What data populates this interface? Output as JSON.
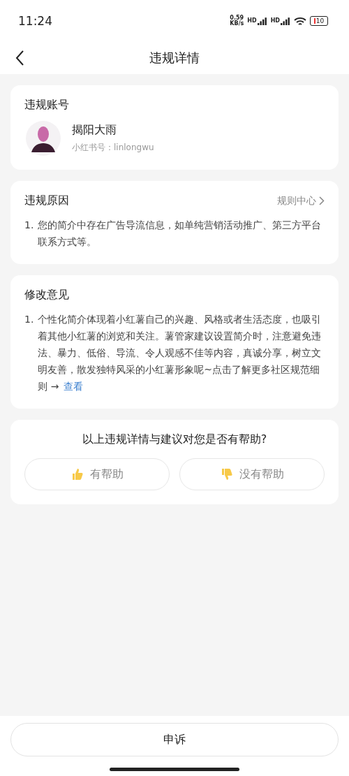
{
  "status_bar": {
    "time": "11:24",
    "speed_value": "0.59",
    "speed_unit": "KB/s",
    "signal_labels": [
      "HD",
      "HD"
    ],
    "battery": "10"
  },
  "header": {
    "title": "违规详情"
  },
  "account": {
    "title": "违规账号",
    "name": "揭阳大雨",
    "handle": "小红书号：linlongwu"
  },
  "reason": {
    "title": "违规原因",
    "link": "规则中心",
    "items": [
      {
        "number": "1.",
        "text": "您的简介中存在广告导流信息，如单纯营销活动推广、第三方平台联系方式等。"
      }
    ]
  },
  "advice": {
    "title": "修改意见",
    "items": [
      {
        "number": "1.",
        "text": "个性化简介体现着小红薯自己的兴趣、风格或者生活态度，也吸引着其他小红薯的浏览和关注。薯管家建议设置简介时，注意避免违法、暴力、低俗、导流、令人观感不佳等内容，真诚分享，树立文明友善，散发独特风采的小红薯形象呢~点击了解更多社区规范细则 →",
        "link": "查看"
      }
    ]
  },
  "feedback": {
    "question": "以上违规详情与建议对您是否有帮助?",
    "options": [
      {
        "kind": "up",
        "label": "有帮助",
        "selected": false
      },
      {
        "kind": "down",
        "label": "没有帮助",
        "selected": false
      }
    ]
  },
  "footer": {
    "button": "申诉"
  }
}
